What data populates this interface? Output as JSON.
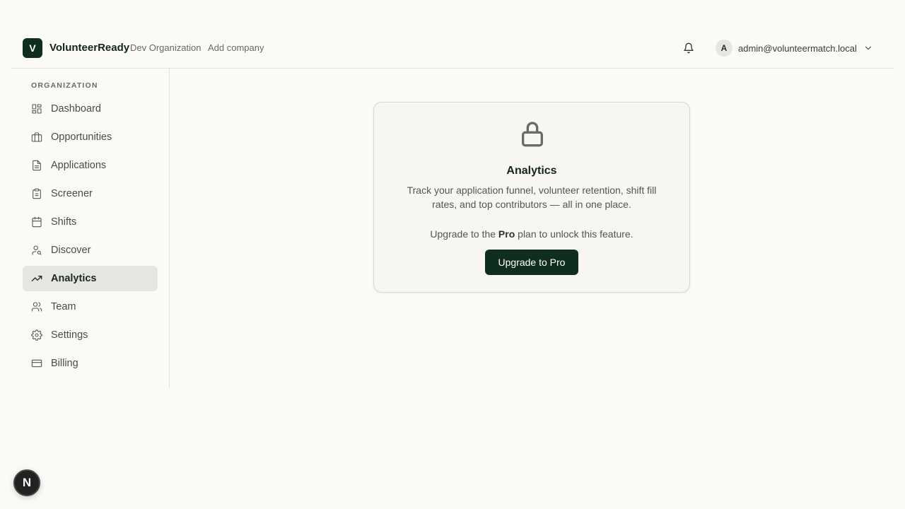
{
  "header": {
    "logo_letter": "V",
    "brand": "VolunteerReady",
    "org_name": "Dev Organization",
    "add_company": "Add company",
    "notification_icon": "bell-icon",
    "user": {
      "avatar_letter": "A",
      "email": "admin@volunteermatch.local",
      "dropdown_icon": "chevron-down-icon"
    }
  },
  "sidebar": {
    "section_label": "ORGANIZATION",
    "items": [
      {
        "label": "Dashboard",
        "icon": "dashboard-icon",
        "active": false
      },
      {
        "label": "Opportunities",
        "icon": "briefcase-icon",
        "active": false
      },
      {
        "label": "Applications",
        "icon": "file-text-icon",
        "active": false
      },
      {
        "label": "Screener",
        "icon": "clipboard-icon",
        "active": false
      },
      {
        "label": "Shifts",
        "icon": "calendar-icon",
        "active": false
      },
      {
        "label": "Discover",
        "icon": "user-search-icon",
        "active": false
      },
      {
        "label": "Analytics",
        "icon": "trending-up-icon",
        "active": true
      },
      {
        "label": "Team",
        "icon": "users-icon",
        "active": false
      },
      {
        "label": "Settings",
        "icon": "gear-icon",
        "active": false
      },
      {
        "label": "Billing",
        "icon": "credit-card-icon",
        "active": false
      }
    ]
  },
  "main": {
    "locked_card": {
      "icon": "lock-icon",
      "title": "Analytics",
      "description": "Track your application funnel, volunteer retention, shift fill rates, and top contributors — all in one place.",
      "upgrade_prefix": "Upgrade to the ",
      "plan_name": "Pro",
      "upgrade_suffix": " plan to unlock this feature.",
      "button_label": "Upgrade to Pro"
    }
  },
  "dev_badge": {
    "letter": "N"
  },
  "colors": {
    "brand": "#0f2e1f",
    "background": "#fcfaf6",
    "active_nav": "#e6e6e0"
  }
}
